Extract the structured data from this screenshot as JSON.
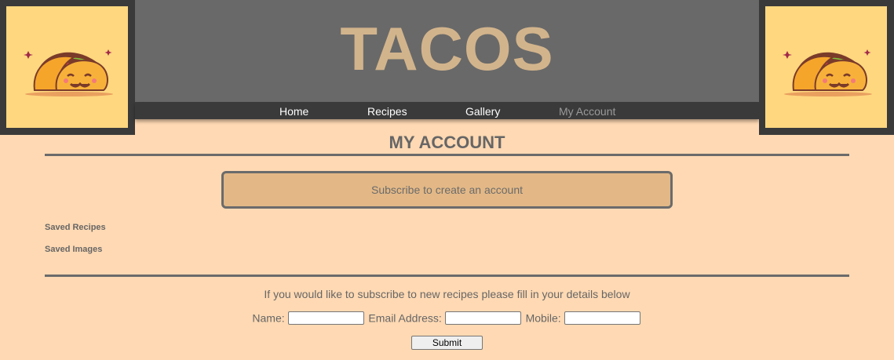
{
  "header": {
    "title": "TACOS",
    "logo_icon": "taco-icon",
    "title_color": "#d2b48c",
    "band_color": "#696969"
  },
  "nav": {
    "items": [
      {
        "label": "Home",
        "active": false
      },
      {
        "label": "Recipes",
        "active": false
      },
      {
        "label": "Gallery",
        "active": false
      },
      {
        "label": "My Account",
        "active": true
      }
    ]
  },
  "main": {
    "heading": "MY ACCOUNT",
    "subscribe_box": "Subscribe to create an account",
    "saved_recipes": "Saved Recipes",
    "saved_images": "Saved Images"
  },
  "subscribe_form": {
    "intro": "If you would like to subscribe to new recipes please fill in your details below",
    "name_label": "Name:",
    "name_value": "",
    "email_label": "Email Address:",
    "email_value": "",
    "mobile_label": "Mobile:",
    "mobile_value": "",
    "submit_label": "Submit"
  },
  "colors": {
    "background": "#ffd9b3",
    "nav_background": "#3a3a3a",
    "logo_background": "#ffd77f",
    "subscribe_box": "#e3b886"
  }
}
